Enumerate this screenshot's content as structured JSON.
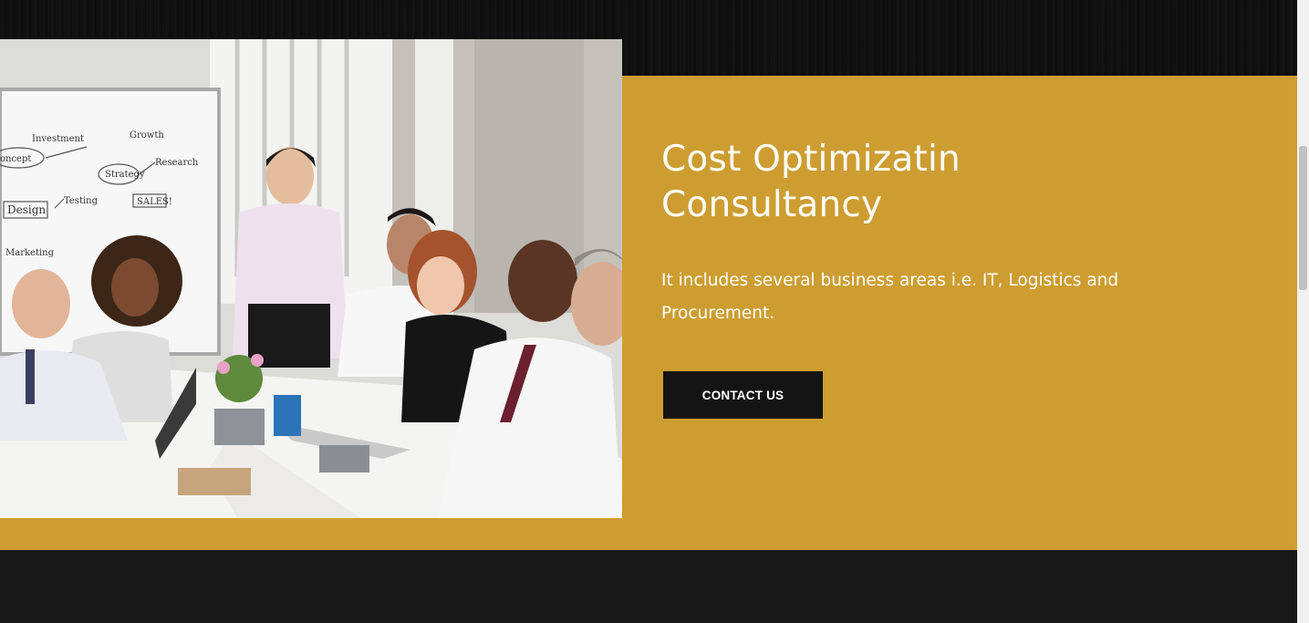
{
  "hero": {
    "title_line1": "Cost Optimizatin",
    "title_line2": "Consultancy",
    "description": "It includes several business areas i.e. IT, Logistics and Procurement.",
    "cta_label": "CONTACT US"
  },
  "photo": {
    "whiteboard_words": [
      "Investment",
      "Growth",
      "Concept",
      "Strategy",
      "Research",
      "Design",
      "Testing",
      "SALES!",
      "Marketing"
    ]
  },
  "colors": {
    "accent_gold": "#cd9d31",
    "dark": "#181818",
    "button": "#141414",
    "text": "#ffffff"
  }
}
